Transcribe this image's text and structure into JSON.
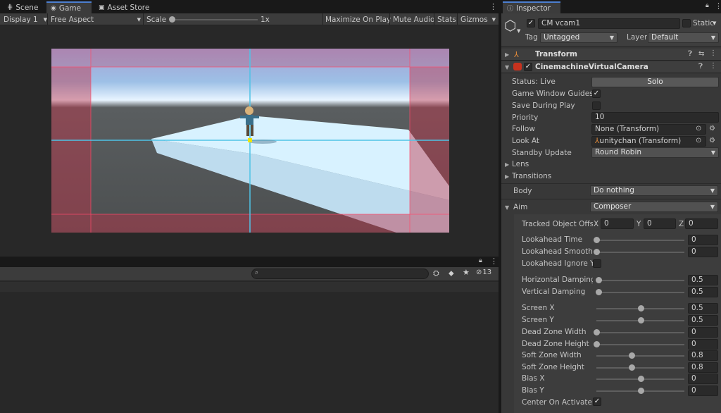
{
  "tabs": {
    "scene": "Scene",
    "game": "Game",
    "asset_store": "Asset Store"
  },
  "game_toolbar": {
    "display": "Display 1",
    "aspect": "Free Aspect",
    "scale_label": "Scale",
    "scale_value": "1x",
    "scale_level": 0.1,
    "maximize": "Maximize On Play",
    "mute": "Mute Audio",
    "stats": "Stats",
    "gizmos": "Gizmos"
  },
  "console": {
    "search_placeholder": "",
    "hidden_count": "13"
  },
  "inspector": {
    "tab": "Inspector",
    "object_name": "CM vcam1",
    "active": true,
    "static_label": "Static",
    "tag_label": "Tag",
    "tag_value": "Untagged",
    "layer_label": "Layer",
    "layer_value": "Default",
    "transform": "Transform",
    "component": "CinemachineVirtualCamera",
    "status_label": "Status: Live",
    "solo": "Solo",
    "game_window_guides": "Game Window Guides",
    "save_during_play": "Save During Play",
    "priority_label": "Priority",
    "priority_value": "10",
    "follow_label": "Follow",
    "follow_value": "None (Transform)",
    "look_at_label": "Look At",
    "look_at_value": "unitychan (Transform)",
    "standby_label": "Standby Update",
    "standby_value": "Round Robin",
    "lens": "Lens",
    "transitions": "Transitions",
    "body_label": "Body",
    "body_value": "Do nothing",
    "aim_label": "Aim",
    "aim_value": "Composer",
    "tracked_label": "Tracked Object Offse",
    "x_label": "X",
    "x_value": "0",
    "y_label": "Y",
    "y_value": "0",
    "z_label": "Z",
    "z_value": "0",
    "lookahead_ignore_y": "Lookahead Ignore Y",
    "center_on_activate": "Center On Activate",
    "sliders": [
      {
        "label": "Lookahead Time",
        "value": "0",
        "fraction": 0.0
      },
      {
        "label": "Lookahead Smoothir",
        "value": "0",
        "fraction": 0.0
      },
      {
        "label": "Horizontal Damping",
        "value": "0.5",
        "fraction": 0.025
      },
      {
        "label": "Vertical Damping",
        "value": "0.5",
        "fraction": 0.025
      },
      {
        "label": "Screen X",
        "value": "0.5",
        "fraction": 0.5
      },
      {
        "label": "Screen Y",
        "value": "0.5",
        "fraction": 0.5
      },
      {
        "label": "Dead Zone Width",
        "value": "0",
        "fraction": 0.0
      },
      {
        "label": "Dead Zone Height",
        "value": "0",
        "fraction": 0.0
      },
      {
        "label": "Soft Zone Width",
        "value": "0.8",
        "fraction": 0.4
      },
      {
        "label": "Soft Zone Height",
        "value": "0.8",
        "fraction": 0.4
      },
      {
        "label": "Bias X",
        "value": "0",
        "fraction": 0.5
      },
      {
        "label": "Bias Y",
        "value": "0",
        "fraction": 0.5
      }
    ]
  }
}
